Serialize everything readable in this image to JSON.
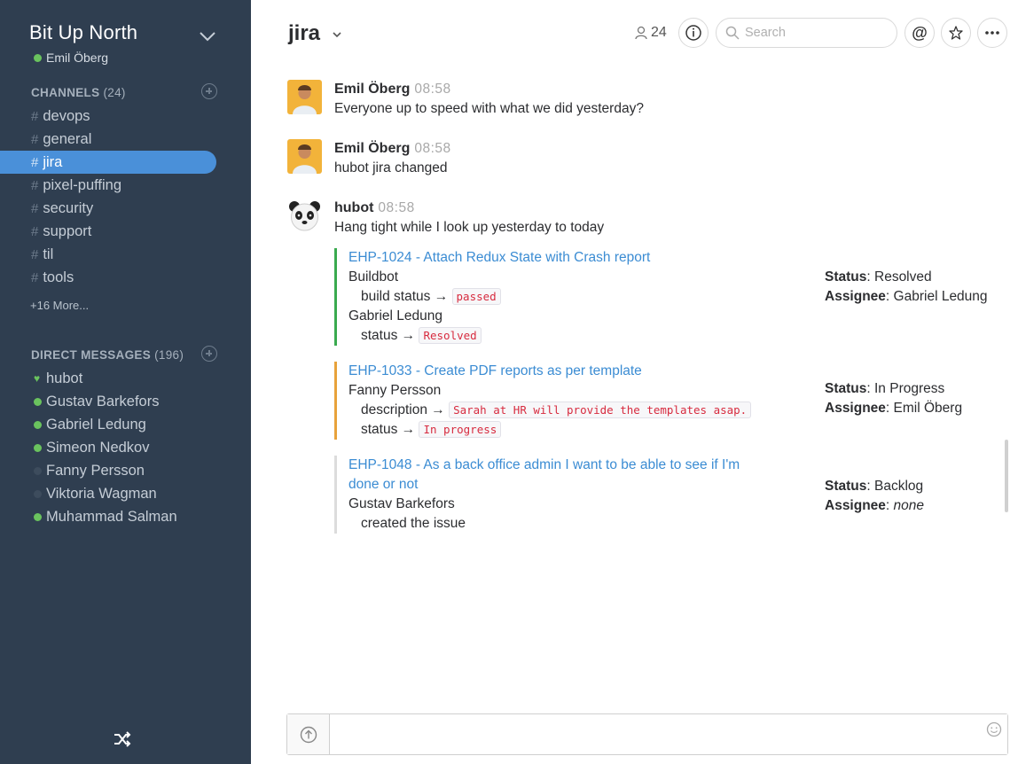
{
  "team": {
    "name": "Bit Up North",
    "user": "Emil Öberg"
  },
  "channels_section": {
    "label": "CHANNELS",
    "count": "(24)",
    "items": [
      {
        "label": "devops"
      },
      {
        "label": "general"
      },
      {
        "label": "jira",
        "active": true
      },
      {
        "label": "pixel-puffing"
      },
      {
        "label": "security"
      },
      {
        "label": "support"
      },
      {
        "label": "til"
      },
      {
        "label": "tools"
      }
    ],
    "more": "+16 More..."
  },
  "dm_section": {
    "label": "DIRECT MESSAGES",
    "count": "(196)",
    "items": [
      {
        "label": "hubot",
        "status": "bot"
      },
      {
        "label": "Gustav Barkefors",
        "status": "online"
      },
      {
        "label": "Gabriel Ledung",
        "status": "online"
      },
      {
        "label": "Simeon Nedkov",
        "status": "online"
      },
      {
        "label": "Fanny Persson",
        "status": "away"
      },
      {
        "label": "Viktoria Wagman",
        "status": "away"
      },
      {
        "label": "Muhammad Salman",
        "status": "online"
      }
    ]
  },
  "header": {
    "channel": "jira",
    "member_count": "24",
    "search_placeholder": "Search"
  },
  "messages": [
    {
      "author": "Emil Öberg",
      "time": "08:58",
      "text": "Everyone up to speed with what we did yesterday?"
    },
    {
      "author": "Emil Öberg",
      "time": "08:58",
      "text": "hubot jira changed"
    },
    {
      "author": "hubot",
      "time": "08:58",
      "text": "Hang tight while I look up yesterday to today"
    }
  ],
  "issues": [
    {
      "title": "EHP-1024 - Attach Redux State with Crash report",
      "actor1": "Buildbot",
      "field1": "build status →",
      "value1": "passed",
      "actor2": "Gabriel Ledung",
      "field2": "status →",
      "value2": "Resolved",
      "status_label": "Status",
      "status": "Resolved",
      "assignee_label": "Assignee",
      "assignee": "Gabriel Ledung"
    },
    {
      "title": "EHP-1033 - Create PDF reports as per template",
      "actor1": "Fanny Persson",
      "field1": "description →",
      "value1": "Sarah at HR will provide the templates asap.",
      "field2": "status →",
      "value2": "In progress",
      "status_label": "Status",
      "status": "In Progress",
      "assignee_label": "Assignee",
      "assignee": "Emil Öberg"
    },
    {
      "title": "EHP-1048 - As a back office admin I want to be able to see if I'm done or not",
      "actor1": "Gustav Barkefors",
      "field1": "created the issue",
      "status_label": "Status",
      "status": "Backlog",
      "assignee_label": "Assignee",
      "assignee": "none"
    }
  ],
  "composer": {
    "placeholder": ""
  },
  "colors": {
    "sidebar": "#2f3e50",
    "active": "#4a90d9",
    "link": "#3b8cd3",
    "online": "#6ac35e"
  }
}
